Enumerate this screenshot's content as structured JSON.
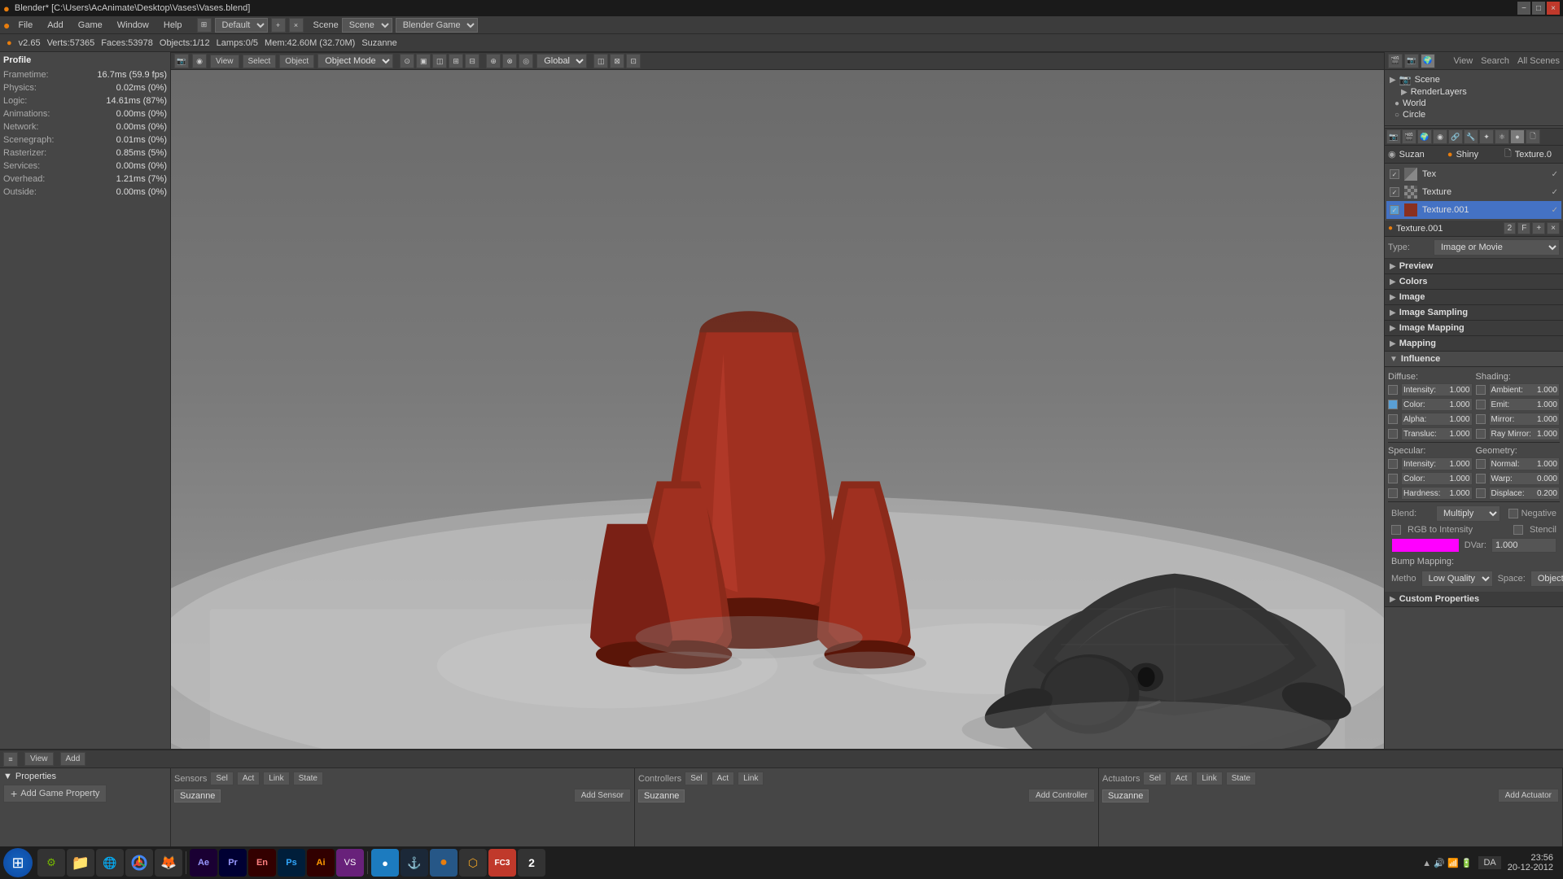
{
  "window": {
    "title": "Blender* [C:\\Users\\AcAnimate\\Desktop\\Vases\\Vases.blend]",
    "close_btn": "×",
    "min_btn": "−",
    "max_btn": "□"
  },
  "menu": {
    "items": [
      "File",
      "Add",
      "Game",
      "Window",
      "Help"
    ]
  },
  "workspace": {
    "layout_label": "Default",
    "scene_label": "Scene",
    "engine_label": "Blender Game"
  },
  "status_bar": {
    "version": "v2.65",
    "verts": "Verts:57365",
    "faces": "Faces:53978",
    "objects": "Objects:1/12",
    "lamps": "Lamps:0/5",
    "mem": "Mem:42.60M (32.70M)",
    "active": "Suzanne"
  },
  "profile": {
    "title": "Profile",
    "rows": [
      {
        "label": "Frametime:",
        "val": "16.7ms (59.9 fps)"
      },
      {
        "label": "Physics:",
        "val": "0.02ms (0%)"
      },
      {
        "label": "Logic:",
        "val": "14.61ms (87%)"
      },
      {
        "label": "Animations:",
        "val": "0.00ms (0%)"
      },
      {
        "label": "Network:",
        "val": "0.00ms (0%)"
      },
      {
        "label": "Scenegraph:",
        "val": "0.01ms (0%)"
      },
      {
        "label": "Rasterizer:",
        "val": "0.85ms (5%)"
      },
      {
        "label": "Services:",
        "val": "0.00ms (0%)"
      },
      {
        "label": "Overhead:",
        "val": "1.21ms (7%)"
      },
      {
        "label": "Outside:",
        "val": "0.00ms (0%)"
      }
    ]
  },
  "viewport_toolbar": {
    "view_label": "View",
    "select_label": "Select",
    "object_label": "Object",
    "mode_label": "Object Mode",
    "global_label": "Global"
  },
  "right_panel": {
    "tabs": [
      "View",
      "Search",
      "All Scenes"
    ],
    "scene_items": [
      {
        "label": "Scene",
        "icon": "▶"
      },
      {
        "label": "RenderLayers",
        "icon": "▶"
      },
      {
        "label": "World",
        "icon": "●"
      },
      {
        "label": "Circle",
        "icon": "○"
      }
    ],
    "material_header": {
      "name": "Suzan",
      "shiny": "Shiny",
      "texture": "Texture.0"
    },
    "texture_list": [
      {
        "name": "Tex",
        "checked": true
      },
      {
        "name": "Texture",
        "checked": true
      },
      {
        "name": "Texture.001",
        "checked": true,
        "active": true
      }
    ],
    "texture_name": "Texture.001",
    "texture_id": "2",
    "type_label": "Type:",
    "type_value": "Image or Movie",
    "sections": [
      {
        "label": "Preview",
        "expanded": false
      },
      {
        "label": "Colors",
        "expanded": false
      },
      {
        "label": "Image",
        "expanded": false
      },
      {
        "label": "Image Sampling",
        "expanded": false
      },
      {
        "label": "Image Mapping",
        "expanded": false
      },
      {
        "label": "Mapping",
        "expanded": false
      },
      {
        "label": "Influence",
        "expanded": true
      }
    ],
    "influence": {
      "diffuse_title": "Diffuse:",
      "shading_title": "Shading:",
      "diffuse_rows": [
        {
          "label": "Intensity:",
          "val": "1.000",
          "checked": false
        },
        {
          "label": "Color:",
          "val": "1.000",
          "checked": true
        },
        {
          "label": "Alpha:",
          "val": "1.000",
          "checked": false
        },
        {
          "label": "Transluc:",
          "val": "1.000",
          "checked": false
        }
      ],
      "shading_rows": [
        {
          "label": "Ambient:",
          "val": "1.000",
          "checked": false
        },
        {
          "label": "Emit:",
          "val": "1.000",
          "checked": false
        },
        {
          "label": "Mirror:",
          "val": "1.000",
          "checked": false
        },
        {
          "label": "Ray Mirror:",
          "val": "1.000",
          "checked": false
        }
      ],
      "specular_title": "Specular:",
      "geometry_title": "Geometry:",
      "specular_rows": [
        {
          "label": "Intensity:",
          "val": "1.000",
          "checked": false
        },
        {
          "label": "Color:",
          "val": "1.000",
          "checked": false
        },
        {
          "label": "Hardness:",
          "val": "1.000",
          "checked": false
        }
      ],
      "geometry_rows": [
        {
          "label": "Normal:",
          "val": "1.000",
          "checked": false
        },
        {
          "label": "Warp:",
          "val": "0.000",
          "checked": false
        },
        {
          "label": "Displace:",
          "val": "0.200",
          "checked": false
        }
      ],
      "blend_label": "Blend:",
      "blend_value": "Multiply",
      "negative_label": "Negative",
      "rgb_label": "RGB to Intensity",
      "stencil_label": "Stencil",
      "dvar_label": "DVar:",
      "dvar_value": "1.000",
      "bump_mapping_label": "Bump Mapping:",
      "method_label": "Metho",
      "method_value": "Low Quality",
      "space_label": "Space:",
      "space_value": "ObjectSpace"
    },
    "custom_properties": "Custom Properties"
  },
  "bottom": {
    "toolbar_items": [
      "Sensors",
      "Controllers",
      "Actuators"
    ],
    "properties_label": "Properties",
    "add_game_property": "Add Game Property",
    "sensors": {
      "label": "Sensors",
      "sel": "Sel",
      "act": "Act",
      "link": "Link",
      "state": "State",
      "name": "Suzanne",
      "add_label": "Add Sensor"
    },
    "controllers": {
      "label": "Controllers",
      "sel": "Sel",
      "act": "Act",
      "link": "Link",
      "name": "Suzanne",
      "add_label": "Add Controller"
    },
    "actuators": {
      "label": "Actuators",
      "sel": "Sel",
      "act": "Act",
      "link": "Link",
      "state": "State",
      "name": "Suzanne",
      "add_label": "Add Actuator"
    }
  },
  "taskbar": {
    "icons": [
      {
        "name": "windows-start",
        "symbol": "⊞",
        "color": "#1565c0"
      },
      {
        "name": "asus-icon",
        "symbol": "⚙"
      },
      {
        "name": "folder-icon",
        "symbol": "📁"
      },
      {
        "name": "vpn-icon",
        "symbol": "🌐"
      },
      {
        "name": "chrome-icon",
        "symbol": "●"
      },
      {
        "name": "firefox-icon",
        "symbol": "🦊"
      },
      {
        "name": "after-effects-icon",
        "symbol": "Ae"
      },
      {
        "name": "premiere-icon",
        "symbol": "Pr"
      },
      {
        "name": "encore-icon",
        "symbol": "En"
      },
      {
        "name": "photoshop-icon",
        "symbol": "Ps"
      },
      {
        "name": "illustrator-icon",
        "symbol": "Ai"
      },
      {
        "name": "visual-studio-icon",
        "symbol": "VS"
      },
      {
        "name": "3d-app-icon",
        "symbol": "3D"
      },
      {
        "name": "steam-icon",
        "symbol": "♟"
      },
      {
        "name": "blender-icon",
        "symbol": "●"
      },
      {
        "name": "unknown1-icon",
        "symbol": "⬡"
      },
      {
        "name": "fc3-icon",
        "symbol": "FC3"
      },
      {
        "name": "num2-icon",
        "symbol": "2"
      }
    ],
    "lang": "DA",
    "time": "23:56",
    "date": "20-12-2012"
  }
}
